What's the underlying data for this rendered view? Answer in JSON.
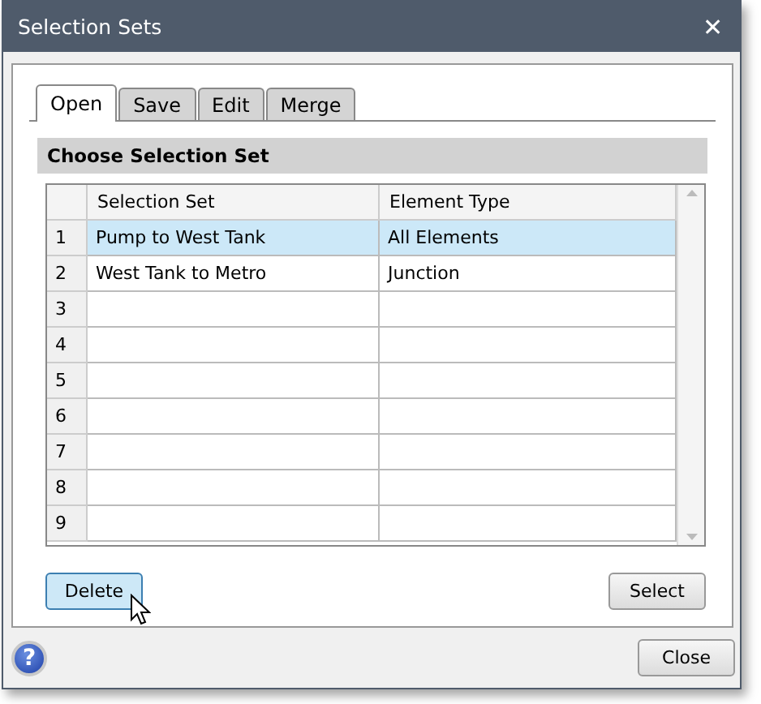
{
  "window": {
    "title": "Selection Sets",
    "close": "✕"
  },
  "tabs": [
    {
      "label": "Open",
      "selected": true
    },
    {
      "label": "Save",
      "selected": false
    },
    {
      "label": "Edit",
      "selected": false
    },
    {
      "label": "Merge",
      "selected": false
    }
  ],
  "section": {
    "title": "Choose Selection Set"
  },
  "table": {
    "columns": [
      "Selection Set",
      "Element Type"
    ],
    "rows": [
      {
        "number": "1",
        "cells": [
          "Pump to West Tank",
          "All Elements"
        ],
        "selected": true
      },
      {
        "number": "2",
        "cells": [
          "West Tank to Metro",
          "Junction"
        ],
        "selected": false
      },
      {
        "number": "3",
        "cells": [],
        "selected": false
      },
      {
        "number": "4",
        "cells": [],
        "selected": false
      },
      {
        "number": "5",
        "cells": [],
        "selected": false
      },
      {
        "number": "6",
        "cells": [],
        "selected": false
      },
      {
        "number": "7",
        "cells": [],
        "selected": false
      },
      {
        "number": "8",
        "cells": [],
        "selected": false
      },
      {
        "number": "9",
        "cells": [],
        "selected": false
      }
    ]
  },
  "buttons": [
    {
      "label": "Delete",
      "hovered": true
    },
    {
      "label": "Select",
      "hovered": false
    }
  ],
  "footer": {
    "help": "?",
    "close": "Close"
  }
}
